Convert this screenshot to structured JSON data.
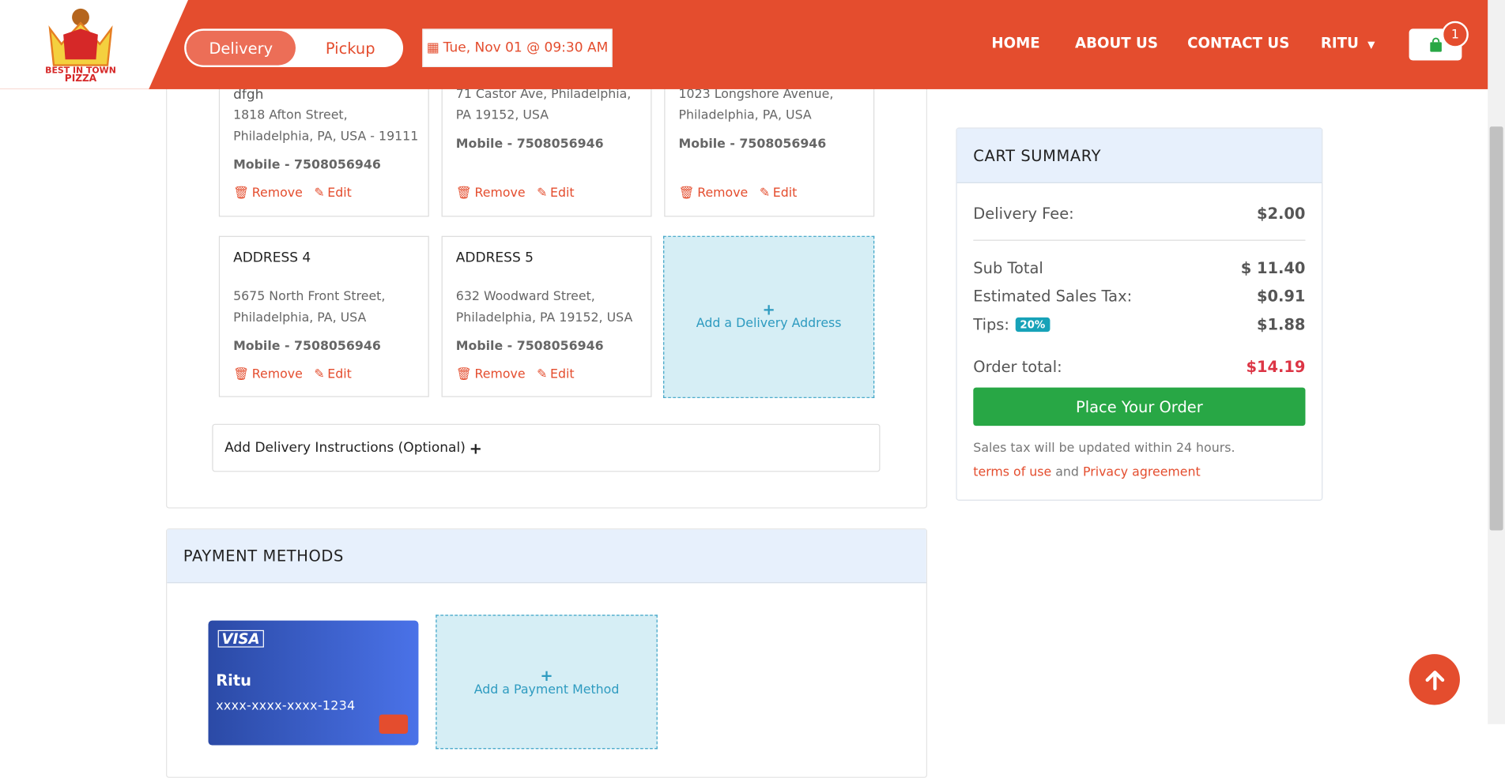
{
  "header": {
    "delivery_label": "Delivery",
    "pickup_label": "Pickup",
    "date_label": "Tue, Nov 01 @ 09:30 AM",
    "nav": [
      "HOME",
      "ABOUT US",
      "CONTACT US"
    ],
    "user_label": "RITU",
    "cart_count": "1"
  },
  "logo": {
    "line1": "BEST IN TOWN",
    "line2": "PIZZA"
  },
  "addresses": [
    {
      "name": "dfgh",
      "line1": "1818 Afton Street,",
      "line2": "Philadelphia, PA, USA - 19111",
      "mobile": "Mobile - 7508056946"
    },
    {
      "line1": "71 Castor Ave, Philadelphia,",
      "line2": "PA 19152, USA",
      "mobile": "Mobile - 7508056946"
    },
    {
      "line1": "1023 Longshore Avenue,",
      "line2": "Philadelphia, PA, USA",
      "mobile": "Mobile - 7508056946"
    },
    {
      "title": "ADDRESS 4",
      "line1": "5675 North Front Street,",
      "line2": "Philadelphia, PA, USA",
      "mobile": "Mobile - 7508056946"
    },
    {
      "title": "ADDRESS 5",
      "line1": "632 Woodward Street,",
      "line2": "Philadelphia, PA 19152, USA",
      "mobile": "Mobile - 7508056946"
    }
  ],
  "address_actions": {
    "remove": "Remove",
    "edit": "Edit"
  },
  "add_address_label": "Add a Delivery Address",
  "instructions_label": "Add Delivery Instructions (Optional)",
  "payment": {
    "title": "PAYMENT METHODS",
    "card_brand": "VISA",
    "card_name": "Ritu",
    "card_number": "xxxx-xxxx-xxxx-1234",
    "add_label": "Add a Payment Method"
  },
  "cart_summary": {
    "title": "CART SUMMARY",
    "delivery_fee_label": "Delivery Fee:",
    "delivery_fee": "$2.00",
    "subtotal_label": "Sub Total",
    "subtotal": "$ 11.40",
    "tax_label": "Estimated Sales Tax:",
    "tax": "$0.91",
    "tips_label": "Tips:",
    "tips_percent": "20%",
    "tips": "$1.88",
    "order_total_label": "Order total:",
    "order_total": "$14.19",
    "place_order_label": "Place Your Order",
    "tax_note": "Sales tax will be updated within 24 hours.",
    "terms_label": "terms of use",
    "and_label": "and",
    "privacy_label": "Privacy agreement"
  },
  "colors": {
    "brand": "#e44d2e",
    "order_button": "#28a745",
    "total": "#dc3545",
    "tip_badge": "#17a2b8",
    "panel_header": "#e7f0fc"
  }
}
